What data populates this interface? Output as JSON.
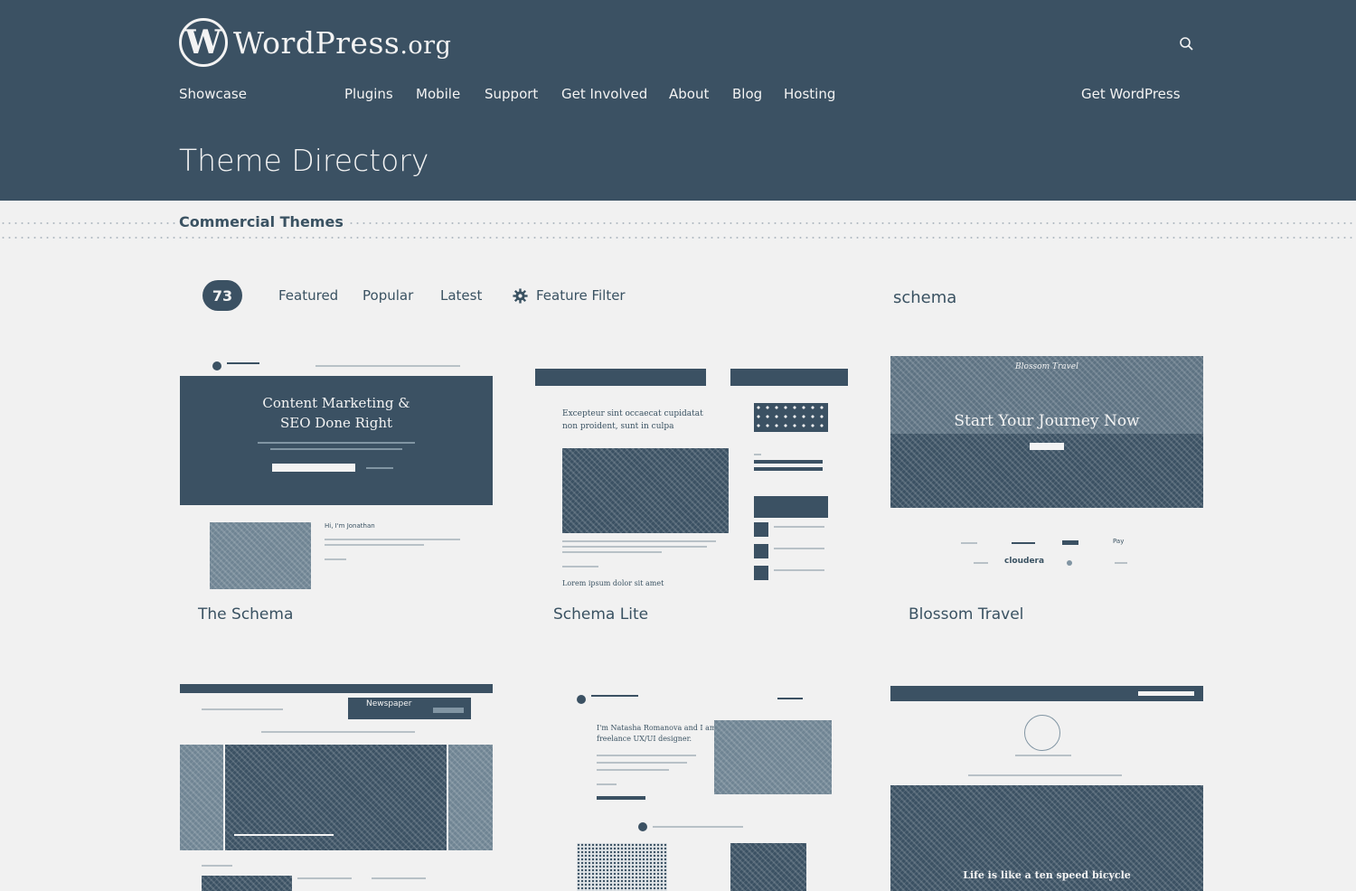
{
  "site": {
    "logo_word": "WordPress",
    "logo_suffix": ".org",
    "search_icon": "search-icon"
  },
  "nav": {
    "items": [
      "Showcase",
      "Plugins",
      "Mobile",
      "Support",
      "Get Involved",
      "About",
      "Blog",
      "Hosting"
    ],
    "cta": "Get WordPress"
  },
  "page": {
    "title": "Theme Directory",
    "subtitle": "Commercial Themes"
  },
  "filters": {
    "count": "73",
    "tabs": [
      "Featured",
      "Popular",
      "Latest"
    ],
    "feature_filter": "Feature Filter",
    "feature_filter_icon": "gear-icon",
    "search_value": "schema"
  },
  "themes": [
    {
      "name": "The Schema",
      "preview": {
        "hero_line1": "Content Marketing &",
        "hero_line2": "SEO Done Right",
        "intro": "Hi, I'm Jonathan"
      }
    },
    {
      "name": "Schema Lite",
      "preview": {
        "headline_line1": "Excepteur sint occaecat cupidatat",
        "headline_line2": "non proident, sunt in culpa",
        "footer_text": "Lorem ipsum dolor sit amet"
      }
    },
    {
      "name": "Blossom Travel",
      "preview": {
        "hero_text": "Start Your Journey Now",
        "brand_script": "Blossom Travel",
        "partner": "cloudera",
        "pay": "Pay"
      }
    },
    {
      "name": "",
      "preview": {
        "badge": "Newspaper"
      }
    },
    {
      "name": "",
      "preview": {
        "intro_line1": "I'm Natasha Romanova and I am a",
        "intro_line2": "freelance UX/UI designer."
      }
    },
    {
      "name": "",
      "preview": {
        "caption": "Life is like a ten speed bicycle"
      }
    }
  ],
  "colors": {
    "header_bg": "#3b5163",
    "page_bg": "#f1f1f1",
    "text": "#3a5262",
    "header_text": "#f3f3f3"
  }
}
